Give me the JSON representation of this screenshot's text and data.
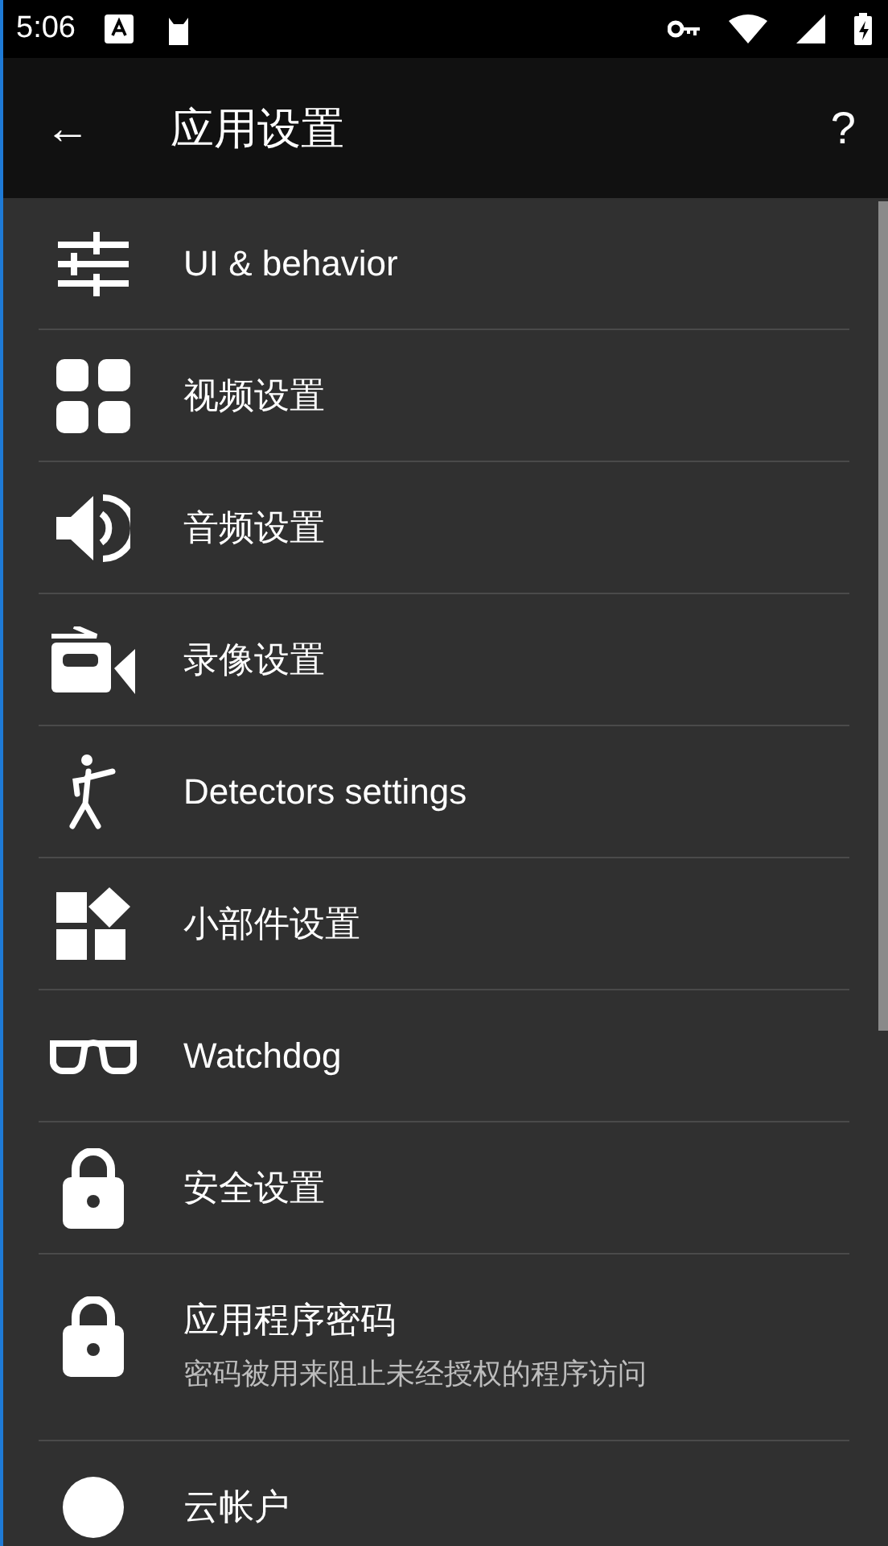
{
  "status_bar": {
    "time": "5:06"
  },
  "toolbar": {
    "back": "←",
    "title": "应用设置",
    "help": "?"
  },
  "items": [
    {
      "title": "UI & behavior"
    },
    {
      "title": "视频设置"
    },
    {
      "title": "音频设置"
    },
    {
      "title": "录像设置"
    },
    {
      "title": "Detectors settings"
    },
    {
      "title": "小部件设置"
    },
    {
      "title": "Watchdog"
    },
    {
      "title": "安全设置"
    },
    {
      "title": "应用程序密码",
      "subtitle": "密码被用来阻止未经授权的程序访问"
    },
    {
      "title": "云帐户"
    }
  ]
}
